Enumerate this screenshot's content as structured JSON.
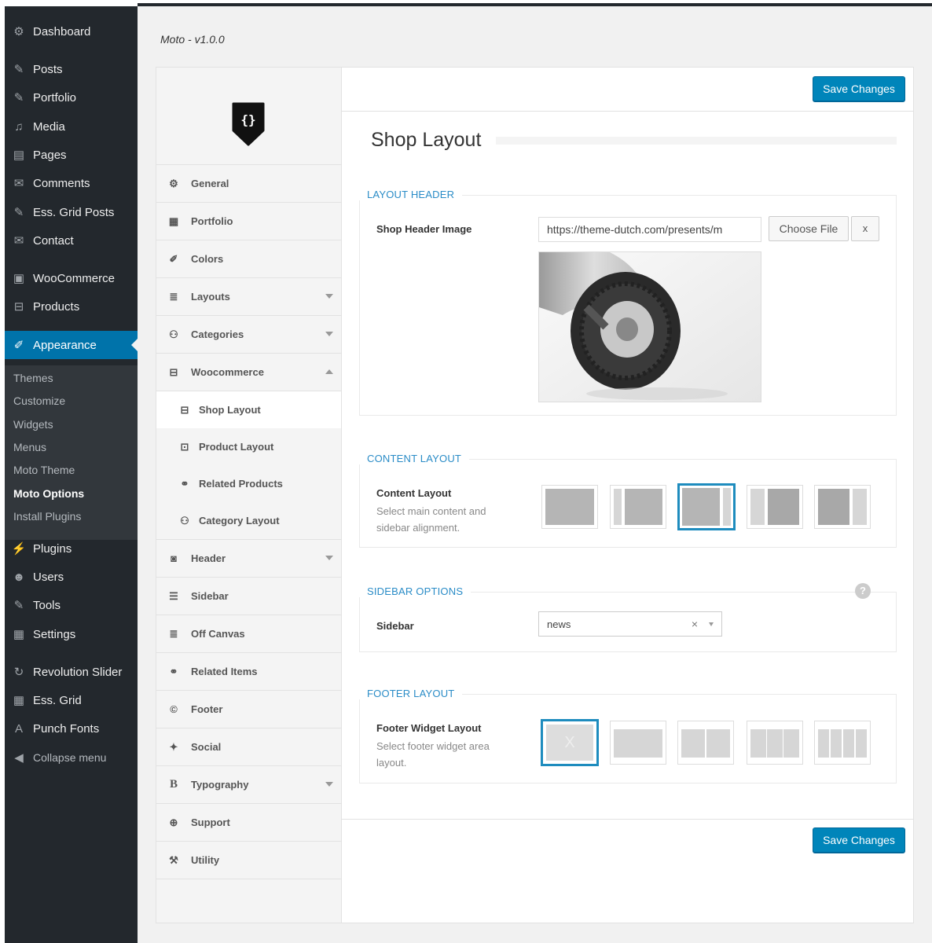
{
  "admin_menu": {
    "items": [
      {
        "label": "Dashboard",
        "icon": "dashboard-icon",
        "glyph": "⚙"
      },
      {
        "label": "Posts",
        "icon": "pin-icon",
        "glyph": "✎"
      },
      {
        "label": "Portfolio",
        "icon": "pin-icon",
        "glyph": "✎"
      },
      {
        "label": "Media",
        "icon": "media-icon",
        "glyph": "♫"
      },
      {
        "label": "Pages",
        "icon": "pages-icon",
        "glyph": "▤"
      },
      {
        "label": "Comments",
        "icon": "comment-icon",
        "glyph": "✉"
      },
      {
        "label": "Ess. Grid Posts",
        "icon": "pin-icon",
        "glyph": "✎"
      },
      {
        "label": "Contact",
        "icon": "mail-icon",
        "glyph": "✉"
      },
      {
        "label": "WooCommerce",
        "icon": "woo-icon",
        "glyph": "▣"
      },
      {
        "label": "Products",
        "icon": "cart-icon",
        "glyph": "⊟"
      },
      {
        "label": "Appearance",
        "icon": "brush-icon",
        "glyph": "✐"
      },
      {
        "label": "Plugins",
        "icon": "plugin-icon",
        "glyph": "⚡"
      },
      {
        "label": "Users",
        "icon": "users-icon",
        "glyph": "☻"
      },
      {
        "label": "Tools",
        "icon": "wrench-icon",
        "glyph": "✎"
      },
      {
        "label": "Settings",
        "icon": "settings-icon",
        "glyph": "▦"
      },
      {
        "label": "Revolution Slider",
        "icon": "refresh-icon",
        "glyph": "↻"
      },
      {
        "label": "Ess. Grid",
        "icon": "grid-icon",
        "glyph": "▦"
      },
      {
        "label": "Punch Fonts",
        "icon": "font-icon",
        "glyph": "A"
      },
      {
        "label": "Collapse menu",
        "icon": "collapse-icon",
        "glyph": "◀"
      }
    ],
    "submenu": [
      "Themes",
      "Customize",
      "Widgets",
      "Menus",
      "Moto Theme",
      "Moto Options",
      "Install Plugins"
    ]
  },
  "version": "Moto - v1.0.0",
  "options_nav": {
    "items": [
      {
        "label": "General",
        "glyph": "⚙"
      },
      {
        "label": "Portfolio",
        "glyph": "▦"
      },
      {
        "label": "Colors",
        "glyph": "✐"
      },
      {
        "label": "Layouts",
        "glyph": "≣"
      },
      {
        "label": "Categories",
        "glyph": "⚇"
      },
      {
        "label": "Woocommerce",
        "glyph": "⊟"
      }
    ],
    "sub_items": [
      {
        "label": "Shop Layout",
        "glyph": "⊟"
      },
      {
        "label": "Product Layout",
        "glyph": "⊡"
      },
      {
        "label": "Related Products",
        "glyph": "⚭"
      },
      {
        "label": "Category Layout",
        "glyph": "⚇"
      }
    ],
    "items2": [
      {
        "label": "Header",
        "glyph": "◙"
      },
      {
        "label": "Sidebar",
        "glyph": "☰"
      },
      {
        "label": "Off Canvas",
        "glyph": "≣"
      },
      {
        "label": "Related Items",
        "glyph": "⚭"
      },
      {
        "label": "Footer",
        "glyph": "©"
      },
      {
        "label": "Social",
        "glyph": "✦"
      },
      {
        "label": "Typography",
        "glyph": "B"
      },
      {
        "label": "Support",
        "glyph": "⊕"
      },
      {
        "label": "Utility",
        "glyph": "⚒"
      }
    ]
  },
  "content": {
    "save_label": "Save Changes",
    "page_title": "Shop Layout",
    "layout_header": {
      "title": "LAYOUT HEADER",
      "field_label": "Shop Header Image",
      "url_value": "https://theme-dutch.com/presents/m",
      "choose_label": "Choose File",
      "remove_label": "x"
    },
    "content_layout": {
      "title": "CONTENT LAYOUT",
      "field_label": "Content Layout",
      "desc": "Select main content and sidebar alignment.",
      "selected_index": 2
    },
    "sidebar_options": {
      "title": "SIDEBAR OPTIONS",
      "field_label": "Sidebar",
      "selected": "news",
      "clear": "×",
      "help": "?"
    },
    "footer_layout": {
      "title": "FOOTER LAYOUT",
      "field_label": "Footer Widget Layout",
      "desc": "Select footer widget area layout.",
      "selected_index": 0,
      "none_mark": "X"
    }
  },
  "colors": {
    "accent": "#0085ba",
    "section_title": "#2a8cc7",
    "admin_bg": "#23282d"
  }
}
